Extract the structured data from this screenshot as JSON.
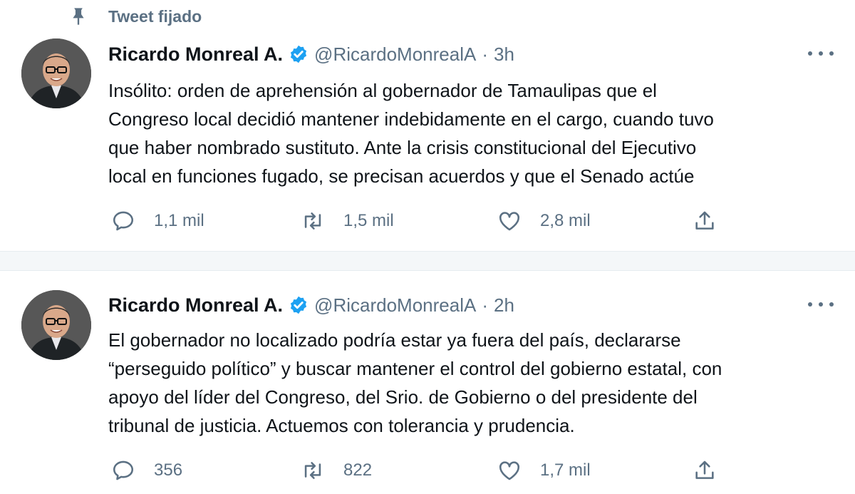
{
  "pinned_label": "Tweet fijado",
  "colors": {
    "accent": "#1da1f2",
    "secondary_text": "#5b7083",
    "primary_text": "#0f1419",
    "separator": "#f4f7f9"
  },
  "icons": {
    "pin": "pin-icon",
    "verified": "verified-badge-icon",
    "more": "more-options-icon",
    "reply": "reply-icon",
    "retweet": "retweet-icon",
    "like": "heart-icon",
    "share": "share-icon"
  },
  "tweets": [
    {
      "author_name": "Ricardo Monreal A.",
      "handle": "@RicardoMonrealA",
      "dot": "·",
      "time": "3h",
      "text": "Insólito: orden de aprehensión al gobernador de Tamaulipas que el\nCongreso local decidió mantener indebidamente en el cargo, cuando tuvo\nque haber nombrado sustituto. Ante la crisis constitucional del Ejecutivo\nlocal en funciones fugado, se precisan acuerdos y que el Senado actúe",
      "replies": "1,1 mil",
      "retweets": "1,5 mil",
      "likes": "2,8 mil"
    },
    {
      "author_name": "Ricardo Monreal A.",
      "handle": "@RicardoMonrealA",
      "dot": "·",
      "time": "2h",
      "text": "El gobernador no localizado podría estar ya fuera del país, declararse\n“perseguido político” y buscar mantener el control del gobierno estatal, con\napoyo del líder del Congreso, del Srio. de Gobierno o del presidente del\ntribunal de justicia. Actuemos con tolerancia y prudencia.",
      "replies": "356",
      "retweets": "822",
      "likes": "1,7 mil"
    }
  ]
}
